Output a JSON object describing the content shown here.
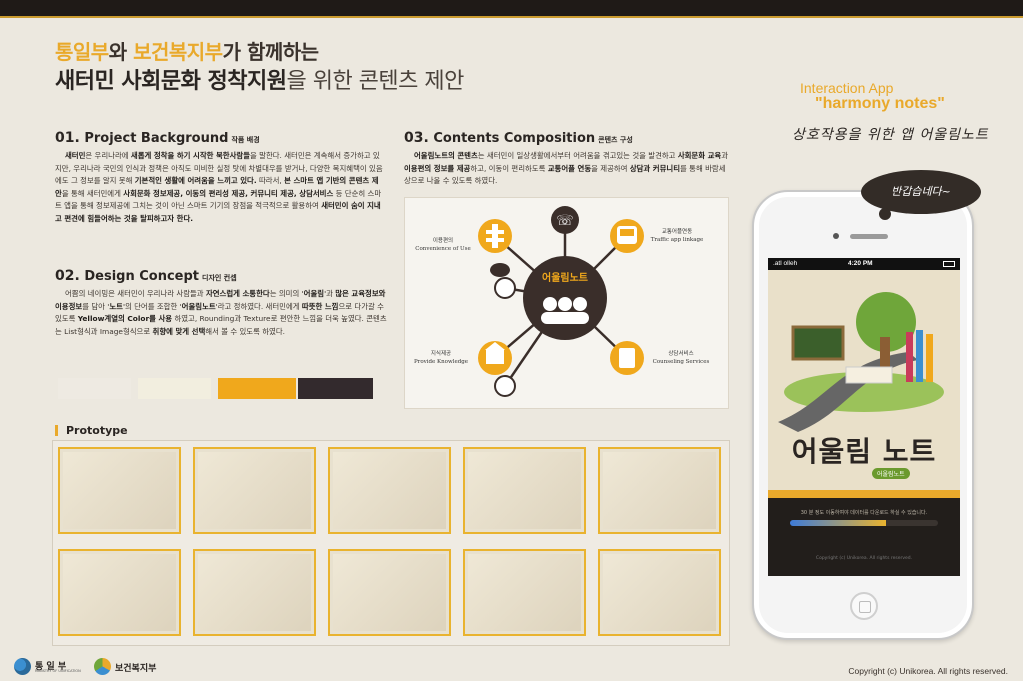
{
  "header": {
    "line1_org1": "통일부",
    "line1_conj": "와 ",
    "line1_org2": "보건복지부",
    "line1_rest": "가 함께하는",
    "line2_bold": "새터민 사회문화 정착지원",
    "line2_rest": "을 위한 콘텐츠 제안"
  },
  "section1": {
    "num": "01.",
    "title": "Project Background",
    "title_ko": "작품 배경",
    "body": [
      {
        "b": "새터민",
        "t": "은 우리나라에 "
      },
      {
        "b": "새롭게 정착을 하기 시작한 북한사람들",
        "t": "을 말한다. 새터민은 계속해서 증가하고 있지만, 우리나라 국민의 인식과 정책은 아직도 미비한 실정 탓에 차별대우를 받거나, 다양한 복지혜택이 있음에도 그 정보를 알지 못해 "
      },
      {
        "b": "기본적인 생활에 어려움을 느끼고 있다.",
        "t": " 따라서, "
      },
      {
        "b": "본 스마트 앱 기반의 콘텐츠 제안",
        "t": "을 통해 새터민에게 "
      },
      {
        "b": "사회문화 정보제공, 이동의 편리성 제공, 커뮤니티 제공, 상담서비스",
        "t": " 등 단순히 스마트 앱을 통해 정보제공에 그치는 것이 아닌 스마트 기기의 장점을 적극적으로 활용하여 "
      },
      {
        "b": "새터민이 숨이 지내고 편견에 힘들어하는 것을 탈피하고자 한다.",
        "t": ""
      }
    ]
  },
  "section2": {
    "num": "02.",
    "title": "Design Concept",
    "title_ko": "디자인 컨셉",
    "body": [
      {
        "b": "",
        "t": "어쁨의 네이밍은 새터민이 우리나라 사람들과 "
      },
      {
        "b": "자연스럽게 소통한다",
        "t": "는 의미의 '"
      },
      {
        "b": "어울림",
        "t": "'과 "
      },
      {
        "b": "많은 교육정보와 이용정보",
        "t": "를 담아 '"
      },
      {
        "b": "노트",
        "t": "'의 단어를 조합한 '"
      },
      {
        "b": "어울림노트",
        "t": "'라고 정하였다. 새터민에게 "
      },
      {
        "b": "따뜻한 느낌",
        "t": "으로 다가갈 수 있도록 "
      },
      {
        "b": "Yellow계열의 Color를 사용",
        "t": " 하였고, Rounding과 Texture로 편안한 느낌을 더욱 높였다. 콘텐츠는 List형식과 Image형식으로 "
      },
      {
        "b": "취향에 맞게 선택",
        "t": "해서 볼 수 있도록 하였다."
      }
    ],
    "palette": [
      "#eeeae2",
      "#f2eedf",
      "#f0a81c",
      "#332a2d"
    ]
  },
  "section3": {
    "num": "03.",
    "title": "Contents Composition",
    "title_ko": "콘텐츠 구성",
    "body": [
      {
        "b": "어울림노트의 콘텐츠",
        "t": "는 새터민이 일상생활에서부터 어려움을 겪고있는 것을 발견하고 "
      },
      {
        "b": "사회문화 교육",
        "t": "과 "
      },
      {
        "b": "이용편의 정보를 제공",
        "t": "하고, 이동이 편리하도록 "
      },
      {
        "b": "교통어플 연동",
        "t": "을 제공하여 "
      },
      {
        "b": "상담과 커뮤니티",
        "t": "를 통해 바람세상으로 나올 수 있도록 하였다."
      }
    ],
    "diagram": {
      "center": "어울림노트",
      "nodes": [
        {
          "ko": "이용편의",
          "en": "Convenience of Use"
        },
        {
          "ko": "교통어플연동",
          "en": "Traffic app linkage"
        },
        {
          "ko": "지식제공",
          "en": "Provide Knowledge"
        },
        {
          "ko": "상담서비스",
          "en": "Counseling Services"
        }
      ]
    }
  },
  "prototype": {
    "title": "Prototype",
    "thumbs": [
      "#e9b32f",
      "#e9b32f",
      "#e9b32f",
      "#e9b32f",
      "#e9b32f",
      "#e9b32f",
      "#e9b32f",
      "#e9b32f",
      "#e9b32f",
      "#e9b32f"
    ]
  },
  "app": {
    "line1": "Interaction App",
    "line2": "\"harmony notes\"",
    "script": "상호작용을 위한 앱 어울림노트",
    "bubble": "반갑습네다~",
    "status_carrier": ".atl olleh",
    "status_time": "4:20 PM",
    "screen_title": "어울림 노트",
    "screen_sub": "어울림노트",
    "screen_note": "30 분 정도 이동하여야 데이터를 다운로드 하실 수 있습니다.",
    "screen_copy": "Copyright (c) Unikorea. All rights reserved.",
    "progress": 0.65
  },
  "footer": {
    "logo1": "통 일 부",
    "logo1_sub": "MINISTRY OF UNIFICATION",
    "logo2": "보건복지부",
    "copyright": "Copyright (c) Unikorea. All rights reserved."
  }
}
